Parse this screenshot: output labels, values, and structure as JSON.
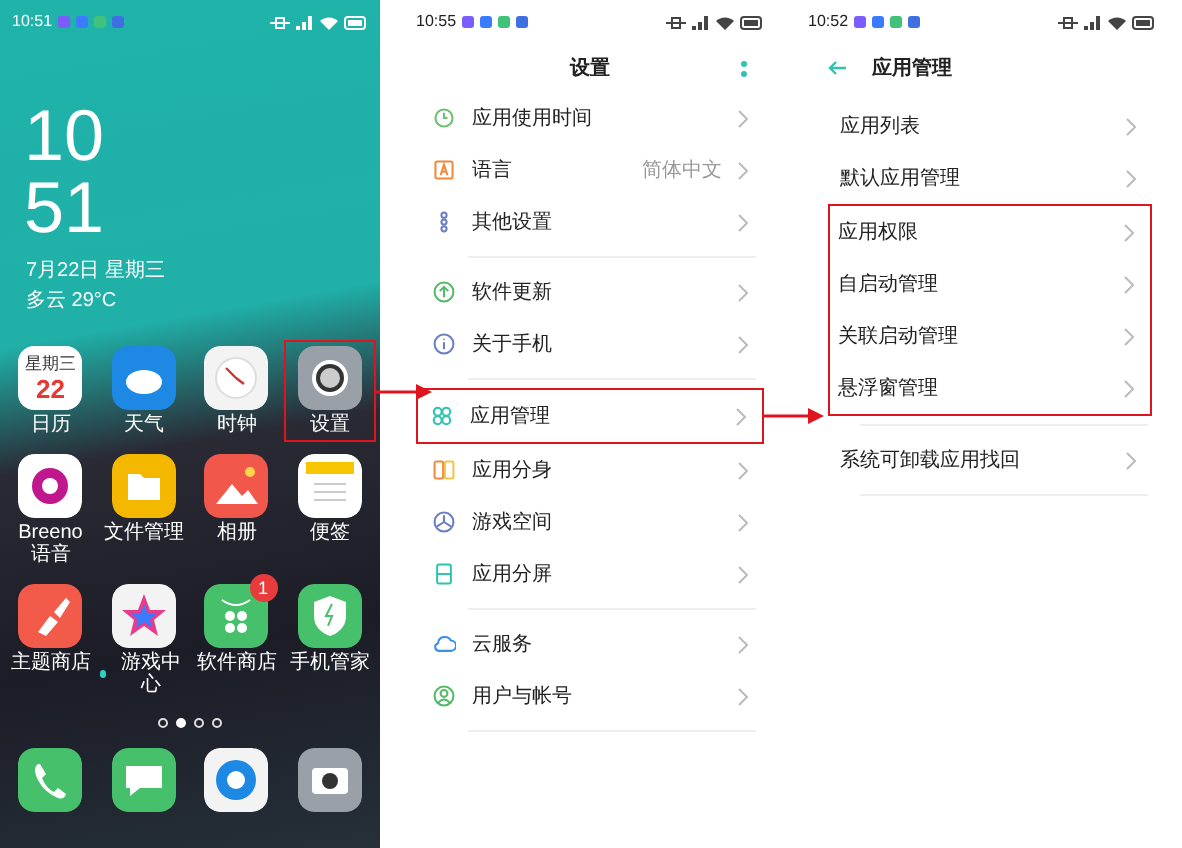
{
  "screens": [
    {
      "kind": "home",
      "status_time": "10:51",
      "clock_hour": "10",
      "clock_minute": "51",
      "date": "7月22日 星期三",
      "weather": "多云 29°C",
      "apps": [
        {
          "kind": "calendar",
          "label": "日历",
          "icon_weekday": "星期三",
          "icon_day": "22",
          "highlighted": false
        },
        {
          "kind": "weather",
          "label": "天气",
          "highlighted": false
        },
        {
          "kind": "clock",
          "label": "时钟",
          "highlighted": false
        },
        {
          "kind": "settings",
          "label": "设置",
          "highlighted": true
        },
        {
          "kind": "voice",
          "label": "Breeno 语音",
          "highlighted": false
        },
        {
          "kind": "files",
          "label": "文件管理",
          "highlighted": false
        },
        {
          "kind": "photos",
          "label": "相册",
          "highlighted": false
        },
        {
          "kind": "notes",
          "label": "便签",
          "highlighted": false
        },
        {
          "kind": "theme",
          "label": "主题商店",
          "highlighted": false
        },
        {
          "kind": "games",
          "label": "游戏中心",
          "new_dot": true,
          "highlighted": false
        },
        {
          "kind": "store",
          "label": "软件商店",
          "badge": "1",
          "highlighted": false
        },
        {
          "kind": "manager",
          "label": "手机管家",
          "highlighted": false
        }
      ],
      "page_dots": [
        {
          "selected": false
        },
        {
          "selected": true
        },
        {
          "selected": false
        },
        {
          "selected": false
        }
      ],
      "dock": [
        {
          "kind": "phone"
        },
        {
          "kind": "messages"
        },
        {
          "kind": "browser"
        },
        {
          "kind": "camera"
        }
      ]
    },
    {
      "kind": "settings",
      "status_time": "10:55",
      "title": "设置",
      "groups": [
        [
          {
            "kind": "usage",
            "label": "应用使用时间",
            "highlighted": false
          },
          {
            "kind": "language",
            "label": "语言",
            "value": "简体中文",
            "highlighted": false
          },
          {
            "kind": "more",
            "label": "其他设置",
            "highlighted": false
          }
        ],
        [
          {
            "kind": "update",
            "label": "软件更新",
            "highlighted": false
          },
          {
            "kind": "about",
            "label": "关于手机",
            "highlighted": false
          }
        ],
        [
          {
            "kind": "apps",
            "label": "应用管理",
            "highlighted": true
          },
          {
            "kind": "clone",
            "label": "应用分身",
            "highlighted": false
          },
          {
            "kind": "game",
            "label": "游戏空间",
            "highlighted": false
          },
          {
            "kind": "split",
            "label": "应用分屏",
            "highlighted": false
          }
        ],
        [
          {
            "kind": "cloud",
            "label": "云服务",
            "highlighted": false
          },
          {
            "kind": "account",
            "label": "用户与帐号",
            "highlighted": false
          }
        ]
      ]
    },
    {
      "kind": "list",
      "status_time": "10:52",
      "title": "应用管理",
      "groups": [
        [
          {
            "label": "应用列表",
            "highlighted": false
          },
          {
            "label": "默认应用管理",
            "highlighted": false
          },
          {
            "label": "应用权限",
            "highlighted": true
          },
          {
            "label": "自启动管理",
            "highlighted": true
          },
          {
            "label": "关联启动管理",
            "highlighted": true
          },
          {
            "label": "悬浮窗管理",
            "highlighted": true
          }
        ],
        [
          {
            "label": "系统可卸载应用找回",
            "highlighted": false
          }
        ]
      ]
    }
  ]
}
